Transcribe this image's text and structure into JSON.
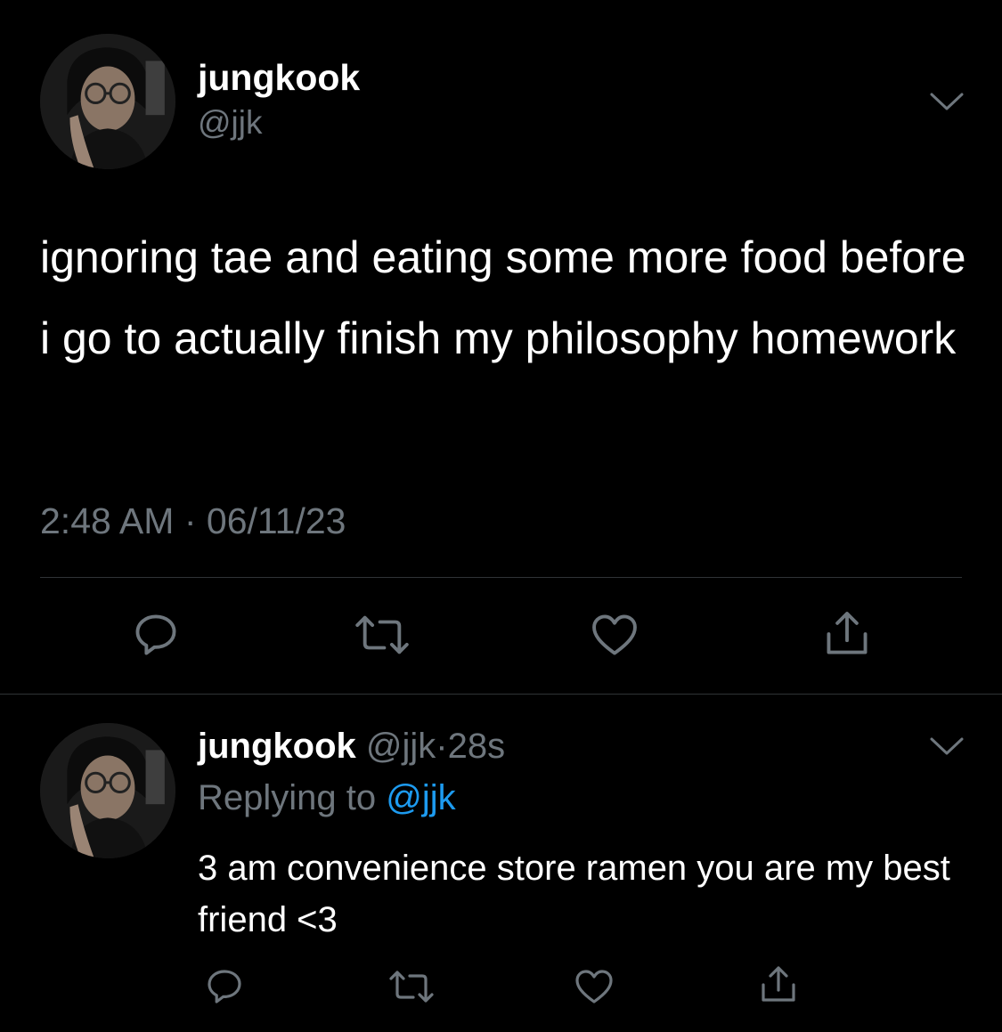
{
  "main_tweet": {
    "display_name": "jungkook",
    "handle": "@jjk",
    "text": "ignoring tae and eating some more food before i go to actually finish my philosophy homework",
    "time": "2:48 AM",
    "separator": "·",
    "date": "06/11/23"
  },
  "reply": {
    "display_name": "jungkook",
    "handle": "@jjk",
    "separator": "·",
    "age": "28s",
    "replying_to_label": "Replying to",
    "replying_to_handle": "@jjk",
    "text": "3 am convenience store ramen you are my best friend <3"
  },
  "actions": [
    "reply-icon",
    "retweet-icon",
    "like-icon",
    "share-icon"
  ],
  "colors": {
    "background": "#000000",
    "primary_text": "#ffffff",
    "secondary_text": "#6e767d",
    "link": "#1d9bf0",
    "divider": "#2f3336"
  }
}
